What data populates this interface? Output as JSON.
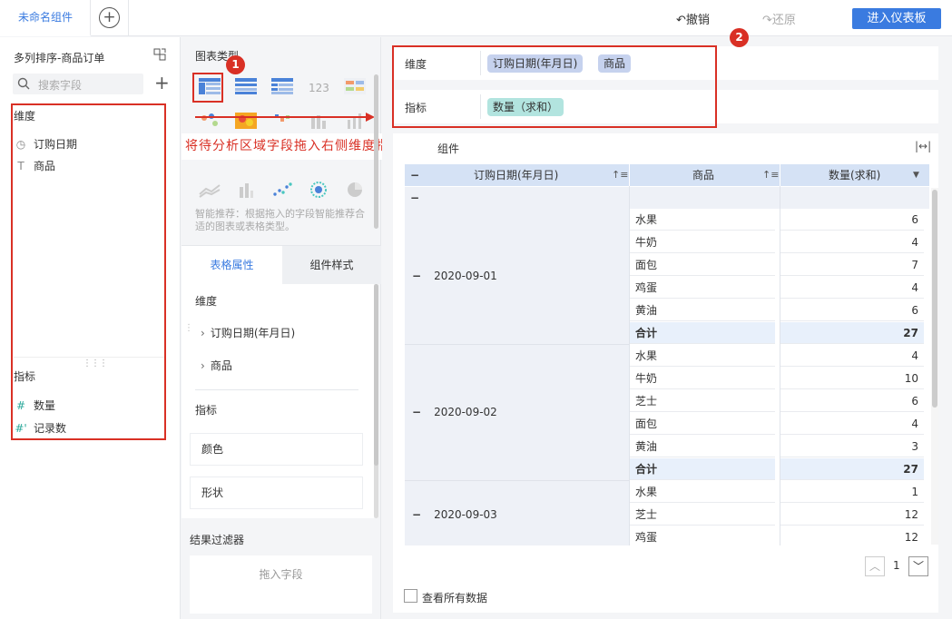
{
  "topbar": {
    "tab_label": "未命名组件",
    "undo_label": "撤销",
    "redo_label": "还原",
    "enter_dashboard_label": "进入仪表板"
  },
  "left": {
    "dataset_name": "多列排序-商品订单",
    "search_placeholder": "搜索字段",
    "dimension_header": "维度",
    "dimension_fields": [
      "订购日期",
      "商品"
    ],
    "measure_header": "指标",
    "measure_fields": [
      "数量",
      "记录数"
    ]
  },
  "middle": {
    "chart_type_header": "图表类型",
    "annotation_badge_1": "1",
    "instruction": "将待分析区域字段拖入右侧维度指标栏",
    "suggest_text": "智能推荐：根据拖入的字段智能推荐合适的图表或表格类型。",
    "tab_attr": "表格属性",
    "tab_style": "组件样式",
    "dim_header": "维度",
    "dim_items": [
      "订购日期(年月日)",
      "商品"
    ],
    "mea_header": "指标",
    "color_label": "颜色",
    "shape_label": "形状",
    "filter_header": "结果过滤器",
    "filter_placeholder": "拖入字段"
  },
  "right": {
    "dim_label": "维度",
    "dim_pills": [
      "订购日期(年月日)",
      "商品"
    ],
    "mea_label": "指标",
    "mea_pills": [
      "数量（求和）"
    ],
    "annotation_badge_2": "2",
    "component_title": "组件",
    "table": {
      "headers": [
        "订购日期(年月日)",
        "商品",
        "数量(求和)"
      ],
      "groups": [
        {
          "date": "2020-09-01",
          "rows": [
            [
              "水果",
              "6"
            ],
            [
              "牛奶",
              "4"
            ],
            [
              "面包",
              "7"
            ],
            [
              "鸡蛋",
              "4"
            ],
            [
              "黄油",
              "6"
            ]
          ],
          "total": [
            "合计",
            "27"
          ]
        },
        {
          "date": "2020-09-02",
          "rows": [
            [
              "水果",
              "4"
            ],
            [
              "牛奶",
              "10"
            ],
            [
              "芝士",
              "6"
            ],
            [
              "面包",
              "4"
            ],
            [
              "黄油",
              "3"
            ]
          ],
          "total": [
            "合计",
            "27"
          ]
        },
        {
          "date": "2020-09-03",
          "rows": [
            [
              "水果",
              "1"
            ],
            [
              "芝士",
              "12"
            ],
            [
              "鸡蛋",
              "12"
            ]
          ],
          "total": null
        }
      ]
    },
    "page_number": "1",
    "view_all_label": "查看所有数据"
  }
}
